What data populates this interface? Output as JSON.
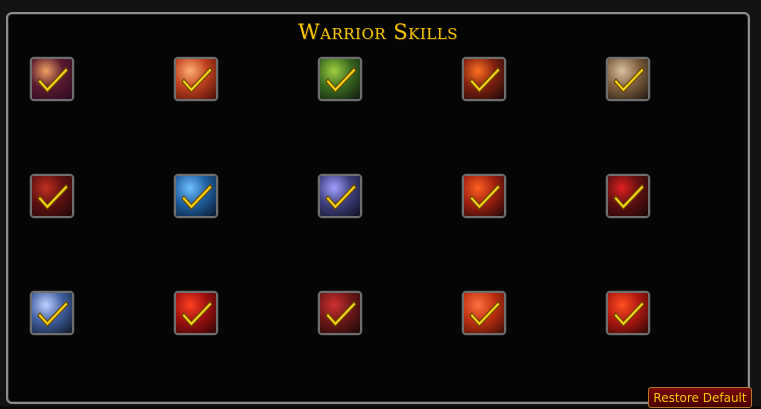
{
  "window": {
    "title": "Warrior Skills"
  },
  "skills": [
    {
      "name": "skill-1-icon",
      "checked": true,
      "colors": [
        "#f0a060",
        "#5a1a30",
        "#2a0a20"
      ]
    },
    {
      "name": "skill-2-icon",
      "checked": true,
      "colors": [
        "#ffb070",
        "#c04020",
        "#4a1008"
      ]
    },
    {
      "name": "skill-3-icon",
      "checked": true,
      "colors": [
        "#a0d040",
        "#3a6a20",
        "#101a10"
      ]
    },
    {
      "name": "skill-4-icon",
      "checked": true,
      "colors": [
        "#ff7020",
        "#802010",
        "#1a0a08"
      ]
    },
    {
      "name": "skill-5-icon",
      "checked": true,
      "colors": [
        "#d8c0a0",
        "#806040",
        "#201810"
      ]
    },
    {
      "name": "skill-6-icon",
      "checked": true,
      "colors": [
        "#c03020",
        "#601010",
        "#200808"
      ]
    },
    {
      "name": "skill-7-icon",
      "checked": true,
      "colors": [
        "#70c0ff",
        "#2060a0",
        "#081830"
      ]
    },
    {
      "name": "skill-8-icon",
      "checked": true,
      "colors": [
        "#a0a0ff",
        "#404080",
        "#101020"
      ]
    },
    {
      "name": "skill-9-icon",
      "checked": true,
      "colors": [
        "#ff6020",
        "#a02010",
        "#200808"
      ]
    },
    {
      "name": "skill-10-icon",
      "checked": true,
      "colors": [
        "#e02020",
        "#601010",
        "#1a0505"
      ]
    },
    {
      "name": "skill-11-icon",
      "checked": true,
      "colors": [
        "#c0d0ff",
        "#4060a0",
        "#101828"
      ]
    },
    {
      "name": "skill-12-icon",
      "checked": true,
      "colors": [
        "#ff4020",
        "#a01010",
        "#300505"
      ]
    },
    {
      "name": "skill-13-icon",
      "checked": true,
      "colors": [
        "#d03030",
        "#701818",
        "#1a0808"
      ]
    },
    {
      "name": "skill-14-icon",
      "checked": true,
      "colors": [
        "#ff7040",
        "#c03010",
        "#401008"
      ]
    },
    {
      "name": "skill-15-icon",
      "checked": true,
      "colors": [
        "#ff5020",
        "#b01810",
        "#300805"
      ]
    }
  ],
  "buttons": {
    "restore_default": "Restore Default"
  }
}
